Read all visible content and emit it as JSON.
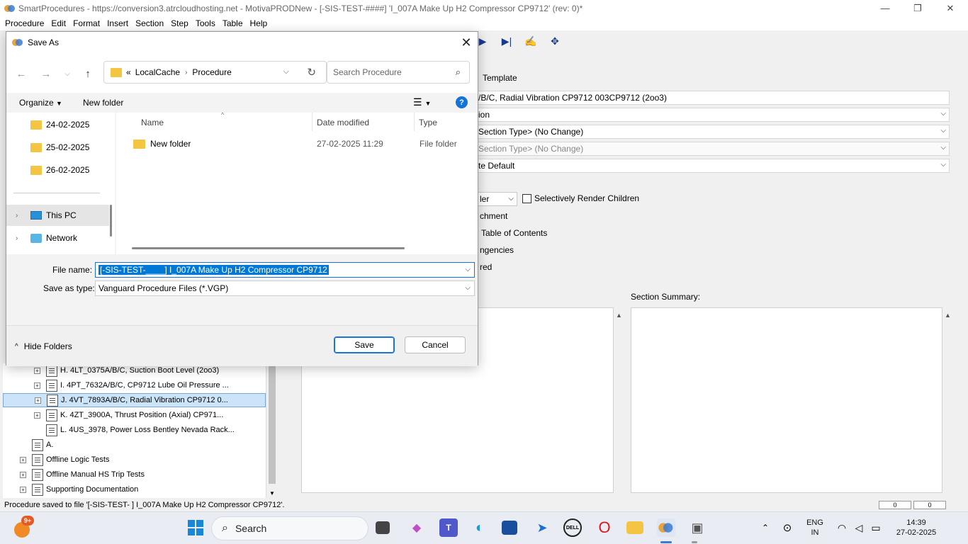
{
  "app": {
    "title": "SmartProcedures - https://conversion3.atrcloudhosting.net - MotivaPRODNew - [-SIS-TEST-####] 'I_007A Make Up H2 Compressor CP9712' (rev: 0)*",
    "menu": [
      "Procedure",
      "Edit",
      "Format",
      "Insert",
      "Section",
      "Step",
      "Tools",
      "Table",
      "Help"
    ],
    "template_tab": "Template",
    "fields": {
      "title_value": "/B/C, Radial Vibration CP9712 003CP9712 (2oo3)",
      "field2": "ion",
      "field3": "Section Type> (No Change)",
      "field4": "Section Type> (No Change)",
      "field5": "te Default",
      "small_select": "ler"
    },
    "checkbox_label": "Selectively Render Children",
    "option_labels": [
      "chment",
      "Table of Contents",
      "ngencies",
      "red"
    ],
    "section_summary_label": "Section Summary:",
    "tree": [
      {
        "label": "H. 4LT_0375A/B/C, Suction Boot Level (2oo3)",
        "indent": 1,
        "expandable": true,
        "selected": false
      },
      {
        "label": "I. 4PT_7632A/B/C, CP9712 Lube Oil Pressure ...",
        "indent": 1,
        "expandable": true,
        "selected": false
      },
      {
        "label": "J. 4VT_7893A/B/C, Radial Vibration CP9712 0...",
        "indent": 1,
        "expandable": true,
        "selected": true
      },
      {
        "label": "K. 4ZT_3900A, Thrust Position (Axial) CP971...",
        "indent": 1,
        "expandable": true,
        "selected": false
      },
      {
        "label": "L. 4US_3978, Power Loss Bentley Nevada Rack...",
        "indent": 1,
        "expandable": false,
        "selected": false
      },
      {
        "label": "A.",
        "indent": 0,
        "expandable": false,
        "selected": false
      },
      {
        "label": "Offline Logic Tests",
        "indent": 0,
        "expandable": true,
        "selected": false
      },
      {
        "label": "Offline Manual HS Trip Tests",
        "indent": 0,
        "expandable": true,
        "selected": false
      },
      {
        "label": "Supporting Documentation",
        "indent": 0,
        "expandable": true,
        "selected": false
      }
    ],
    "status_text": "Procedure saved to file '[-SIS-TEST-     ] I_007A Make Up H2 Compressor CP9712'.",
    "status_boxes": [
      "0",
      "0"
    ]
  },
  "dialog": {
    "title": "Save As",
    "path": {
      "overflow": "«",
      "parts": [
        "LocalCache",
        "Procedure"
      ]
    },
    "search_placeholder": "Search Procedure",
    "organize": "Organize",
    "new_folder": "New folder",
    "help": "?",
    "nav_items": [
      {
        "label": "24-02-2025",
        "kind": "folder"
      },
      {
        "label": "25-02-2025",
        "kind": "folder"
      },
      {
        "label": "26-02-2025",
        "kind": "folder"
      },
      {
        "label": "This PC",
        "kind": "pc"
      },
      {
        "label": "Network",
        "kind": "network"
      }
    ],
    "columns": [
      "Name",
      "Date modified",
      "Type"
    ],
    "files": [
      {
        "name": "New folder",
        "date": "27-02-2025 11:29",
        "type": "File folder"
      }
    ],
    "file_name_label": "File name:",
    "file_name_value": "[-SIS-TEST-____] I_007A Make Up H2 Compressor CP9712",
    "save_type_label": "Save as type:",
    "save_type_value": "Vanguard Procedure Files (*.VGP)",
    "hide_folders": "Hide Folders",
    "save": "Save",
    "cancel": "Cancel"
  },
  "taskbar": {
    "badge": "9+",
    "search_placeholder": "Search",
    "lang_top": "ENG",
    "lang_bottom": "IN",
    "time": "14:39",
    "date": "27-02-2025",
    "apps": [
      "file-explorer-icon",
      "copilot-icon",
      "teams-icon",
      "edge-icon",
      "store-icon",
      "power-automate-icon",
      "dell-icon",
      "opera-icon",
      "folder-icon",
      "smartprocedures-icon",
      "remote-desktop-icon"
    ]
  }
}
